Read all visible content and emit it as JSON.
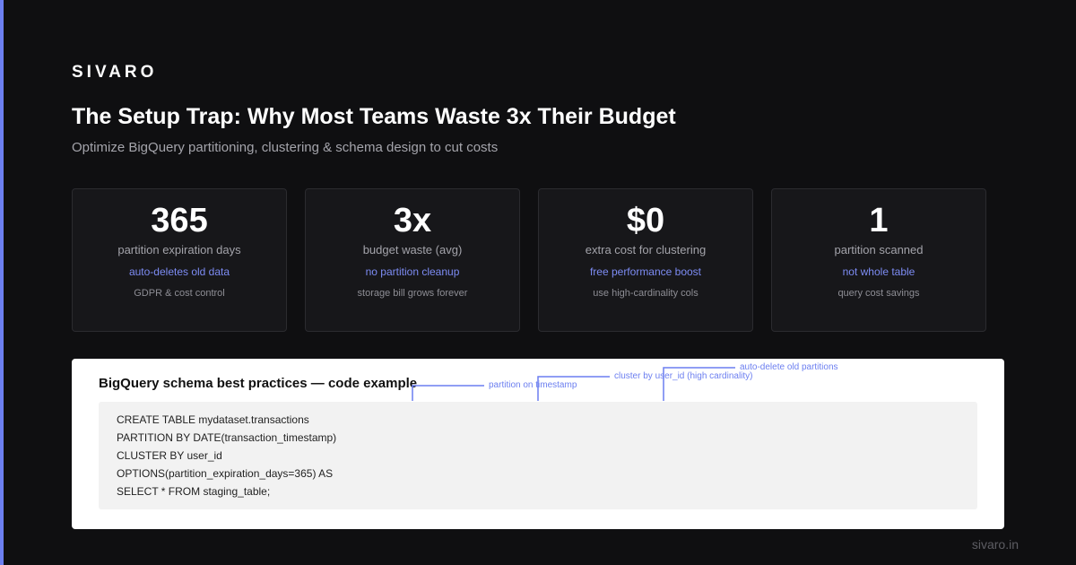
{
  "brand": "SIVARO",
  "title": "The Setup Trap: Why Most Teams Waste 3x Their Budget",
  "subtitle": "Optimize BigQuery partitioning, clustering & schema design to cut costs",
  "colors": {
    "background": "#0f0f11",
    "accent": "#6c7ff0",
    "card": "#17171a",
    "panel": "#ffffff",
    "code_bg": "#f2f2f2"
  },
  "stats": [
    {
      "value": "365",
      "label": "partition expiration days",
      "note": "auto-deletes old data",
      "detail": "GDPR & cost control"
    },
    {
      "value": "3x",
      "label": "budget waste (avg)",
      "note": "no partition cleanup",
      "detail": "storage bill grows forever"
    },
    {
      "value": "$0",
      "label": "extra cost for clustering",
      "note": "free performance boost",
      "detail": "use high-cardinality cols"
    },
    {
      "value": "1",
      "label": "partition scanned",
      "note": "not whole table",
      "detail": "query cost savings"
    }
  ],
  "code_panel": {
    "heading": "BigQuery schema best practices — code example",
    "lines": [
      "CREATE TABLE mydataset.transactions",
      "PARTITION BY DATE(transaction_timestamp)",
      "CLUSTER BY user_id",
      "OPTIONS(partition_expiration_days=365) AS",
      "SELECT * FROM staging_table;"
    ],
    "annotations": [
      "partition on timestamp",
      "cluster by user_id (high cardinality)",
      "auto-delete old partitions"
    ]
  },
  "footer": {
    "url": "sivaro.in"
  }
}
